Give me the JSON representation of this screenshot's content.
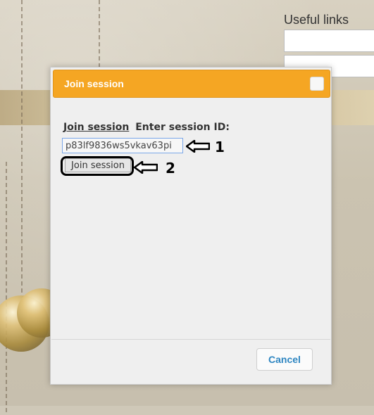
{
  "page": {
    "useful_links_title": "Useful links"
  },
  "dialog": {
    "title": "Join session",
    "form": {
      "link_label": "Join session",
      "prompt_label": "Enter session ID:",
      "session_id_value": "p83lf9836ws5vkav63pi",
      "join_button_label": "Join session"
    },
    "footer": {
      "cancel_label": "Cancel"
    }
  },
  "annotations": {
    "step1": "1",
    "step2": "2"
  },
  "colors": {
    "titlebar": "#f5a623",
    "cancel_text": "#2e86c1",
    "input_border": "#7aa7e8"
  },
  "icons": {
    "dialog_close": "close-icon",
    "annotation_arrow": "left-arrow-icon"
  }
}
